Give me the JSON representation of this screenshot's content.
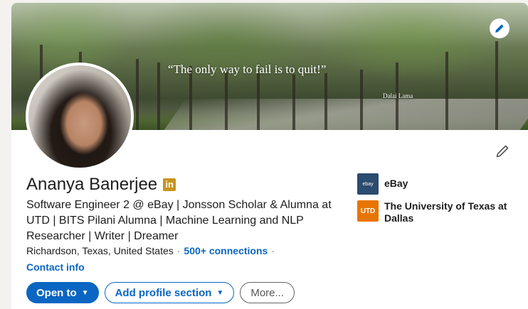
{
  "banner": {
    "quote": "“The only way to fail is to quit!”",
    "author": "Dalai Lama"
  },
  "profile": {
    "name": "Ananya Banerjee",
    "badge": "in",
    "headline": "Software Engineer 2 @ eBay | Jonsson Scholar & Alumna at UTD | BITS Pilani Alumna | Machine Learning and NLP Researcher | Writer | Dreamer",
    "location": "Richardson, Texas, United States",
    "separator": "·",
    "connections": "500+ connections",
    "contact_info": "Contact info"
  },
  "actions": {
    "open_to": "Open to",
    "add_section": "Add profile section",
    "more": "More..."
  },
  "experience": [
    {
      "name": "eBay",
      "logo_text": "ebay",
      "logo_color": "#2b4b6f"
    },
    {
      "name": "The University of Texas at Dallas",
      "logo_text": "UTD",
      "logo_color": "#e87500"
    }
  ],
  "colors": {
    "brand_blue": "#0a66c2",
    "badge_gold": "#c7941f"
  },
  "icons": {
    "banner_edit": "pencil-icon",
    "profile_edit": "pencil-icon",
    "dropdown": "caret-down-icon"
  }
}
